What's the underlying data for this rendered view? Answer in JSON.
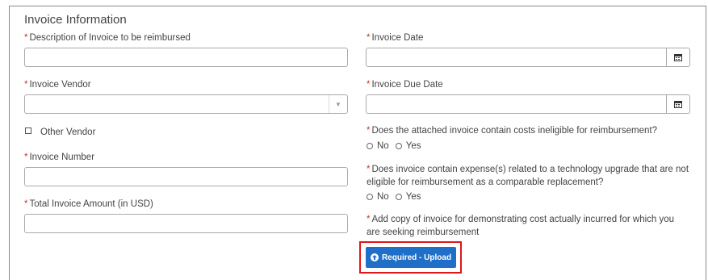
{
  "section": {
    "title": "Invoice Information"
  },
  "left": {
    "description_label": "Description of Invoice to be reimbursed",
    "vendor_label": "Invoice Vendor",
    "other_vendor_label": "Other Vendor",
    "number_label": "Invoice Number",
    "total_label": "Total Invoice Amount (in USD)"
  },
  "right": {
    "date_label": "Invoice Date",
    "due_date_label": "Invoice Due Date",
    "ineligible_q": "Does the attached invoice contain costs ineligible for reimbursement?",
    "tech_q_line1": "Does invoice contain expense(s) related to a technology upgrade that are not",
    "tech_q_line2": "eligible for reimbursement as a comparable replacement?",
    "copy_q_line1": "Add copy of invoice for demonstrating cost actually incurred for which you",
    "copy_q_line2": "are seeking reimbursement",
    "no_label": "No",
    "yes_label": "Yes"
  },
  "upload": {
    "label": "Required - Upload"
  },
  "icons": {
    "calendar": "calendar-icon",
    "dropdown": "chevron-down-icon",
    "upload": "upload-circle-icon"
  },
  "colors": {
    "required": "#c0392b",
    "button": "#1f6fc8",
    "highlight": "#e0161b"
  }
}
